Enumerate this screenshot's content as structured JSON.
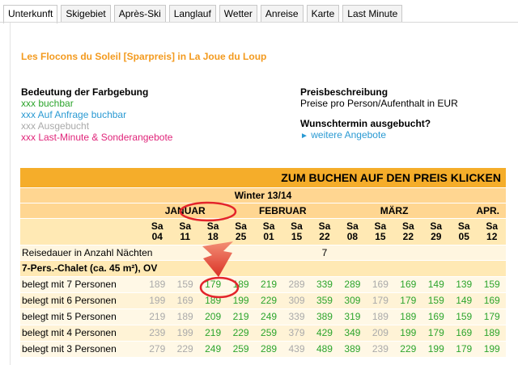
{
  "tabs": [
    "Unterkunft",
    "Skigebiet",
    "Après-Ski",
    "Langlauf",
    "Wetter",
    "Anreise",
    "Karte",
    "Last Minute"
  ],
  "offer_title": "Les Flocons du Soleil [Sparpreis] in La Joue du Loup",
  "legend": {
    "heading": "Bedeutung der Farbgebung",
    "items": [
      {
        "text": "xxx buchbar",
        "color": "#2ca52c"
      },
      {
        "text": "xxx Auf Anfrage buchbar",
        "color": "#2a9ad3"
      },
      {
        "text": "xxx Ausgebucht",
        "color": "#aaaaaa"
      },
      {
        "text": "xxx Last-Minute & Sonderangebote",
        "color": "#e0257a"
      }
    ]
  },
  "price_info": {
    "heading": "Preisbeschreibung",
    "text": "Preise pro Person/Aufenthalt in EUR",
    "alt_heading": "Wunschtermin ausgebucht?",
    "link": "weitere Angebote"
  },
  "table": {
    "banner": "ZUM BUCHEN AUF DEN PREIS KLICKEN",
    "season": "Winter 13/14",
    "months": [
      {
        "name": "JANUAR",
        "span": 3
      },
      {
        "name": "FEBRUAR",
        "span": 4
      },
      {
        "name": "MÄRZ",
        "span": 4
      },
      {
        "name": "APR.",
        "span": 2
      }
    ],
    "weekday": "Sa",
    "dates": [
      "04",
      "11",
      "18",
      "25",
      "01",
      "15",
      "22",
      "08",
      "15",
      "22",
      "29",
      "05",
      "12"
    ],
    "nights_label": "Reisedauer in Anzahl Nächten",
    "nights_value": "7",
    "chalet": "7-Pers.-Chalet (ca. 45 m²), OV",
    "rows": [
      {
        "label": "belegt mit 7 Personen",
        "prices": [
          "189",
          "159",
          "179",
          "189",
          "219",
          "289",
          "339",
          "289",
          "169",
          "169",
          "149",
          "139",
          "159"
        ],
        "status": [
          "g",
          "g",
          "b",
          "b",
          "b",
          "g",
          "b",
          "b",
          "g",
          "b",
          "b",
          "b",
          "b"
        ]
      },
      {
        "label": "belegt mit 6 Personen",
        "prices": [
          "199",
          "169",
          "189",
          "199",
          "229",
          "309",
          "359",
          "309",
          "179",
          "179",
          "159",
          "149",
          "169"
        ],
        "status": [
          "g",
          "g",
          "b",
          "b",
          "b",
          "g",
          "b",
          "b",
          "g",
          "b",
          "b",
          "b",
          "b"
        ]
      },
      {
        "label": "belegt mit 5 Personen",
        "prices": [
          "219",
          "189",
          "209",
          "219",
          "249",
          "339",
          "389",
          "319",
          "189",
          "189",
          "169",
          "159",
          "179"
        ],
        "status": [
          "g",
          "g",
          "b",
          "b",
          "b",
          "g",
          "b",
          "b",
          "g",
          "b",
          "b",
          "b",
          "b"
        ]
      },
      {
        "label": "belegt mit 4 Personen",
        "prices": [
          "239",
          "199",
          "219",
          "229",
          "259",
          "379",
          "429",
          "349",
          "209",
          "199",
          "179",
          "169",
          "189"
        ],
        "status": [
          "g",
          "g",
          "b",
          "b",
          "b",
          "g",
          "b",
          "b",
          "g",
          "b",
          "b",
          "b",
          "b"
        ]
      },
      {
        "label": "belegt mit 3 Personen",
        "prices": [
          "279",
          "229",
          "249",
          "259",
          "289",
          "439",
          "489",
          "389",
          "239",
          "229",
          "199",
          "179",
          "199"
        ],
        "status": [
          "g",
          "g",
          "b",
          "b",
          "b",
          "g",
          "b",
          "b",
          "g",
          "b",
          "b",
          "b",
          "b"
        ]
      }
    ]
  },
  "colors": {
    "accent": "#f39a1e",
    "banner": "#f5ad2a",
    "annotation": "#e3242b"
  }
}
